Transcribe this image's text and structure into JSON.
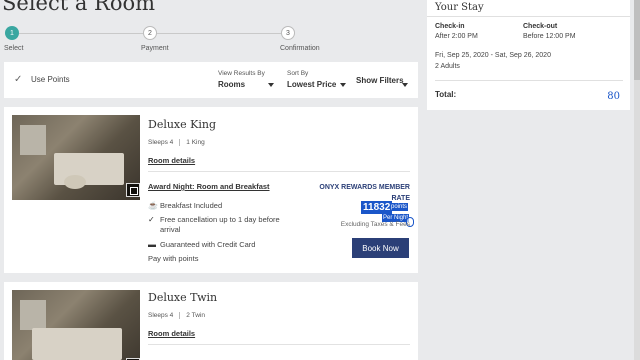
{
  "page_title": "Select a Room",
  "stepper": {
    "steps": [
      {
        "num": "1",
        "label": "Select"
      },
      {
        "num": "2",
        "label": "Payment"
      },
      {
        "num": "3",
        "label": "Confirmation"
      }
    ]
  },
  "filter_bar": {
    "use_points": "Use Points",
    "view_results_label": "View Results By",
    "view_results_value": "Rooms",
    "sort_label": "Sort By",
    "sort_value": "Lowest Price",
    "show_filters": "Show Filters"
  },
  "rooms": [
    {
      "name": "Deluxe King",
      "sleeps": "Sleeps 4",
      "beds": "1 King",
      "details_link": "Room details",
      "rate_name": "Award Night: Room and Breakfast",
      "member_rate_line1": "ONYX REWARDS MEMBER",
      "member_rate_line2": "RATE",
      "features": [
        {
          "icon": "breakfast-icon",
          "text": "Breakfast Included"
        },
        {
          "icon": "check-icon",
          "text": "Free cancellation up to 1 day before arrival"
        },
        {
          "icon": "credit-card-icon",
          "text": "Guaranteed with Credit Card"
        },
        {
          "icon": "",
          "text": "Pay with points"
        }
      ],
      "points": "11832",
      "points_label": "points",
      "per_night": "Per Night",
      "excluding": "Excluding Taxes & Fees",
      "book_label": "Book Now"
    },
    {
      "name": "Deluxe Twin",
      "sleeps": "Sleeps 4",
      "beds": "2 Twin",
      "details_link": "Room details"
    }
  ],
  "stay": {
    "title": "Your Stay",
    "checkin_label": "Check-in",
    "checkin_value": "After 2:00 PM",
    "checkout_label": "Check-out",
    "checkout_value": "Before 12:00 PM",
    "dates": "Fri, Sep 25, 2020 - Sat, Sep 26, 2020",
    "guests": "2 Adults",
    "total_label": "Total:",
    "total_value": "80"
  },
  "colors": {
    "accent_teal": "#3aa7a1",
    "brand_navy": "#2b3f77",
    "highlight_blue": "#1a56c9"
  }
}
